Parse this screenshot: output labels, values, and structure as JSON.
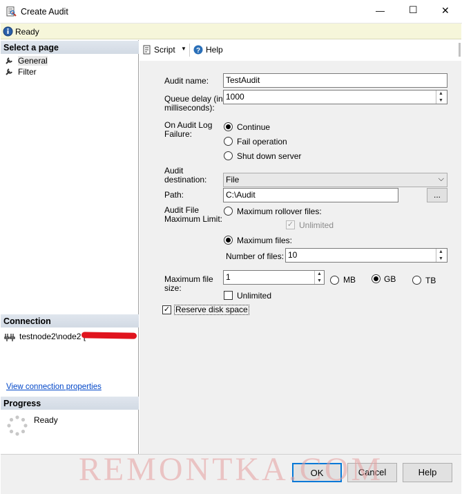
{
  "window": {
    "title": "Create Audit",
    "minimize": "—",
    "maximize": "☐",
    "close": "✕"
  },
  "status": {
    "icon": "info-icon",
    "text": "Ready"
  },
  "left": {
    "select_page_title": "Select a page",
    "pages": [
      {
        "label": "General",
        "icon": "wrench-icon",
        "selected": true
      },
      {
        "label": "Filter",
        "icon": "wrench-icon",
        "selected": false
      }
    ],
    "connection_title": "Connection",
    "connection_server": "testnode2\\node2 [",
    "view_connection_link": "View connection properties",
    "progress_title": "Progress",
    "progress_status": "Ready"
  },
  "toolbar": {
    "script_label": "Script",
    "help_label": "Help"
  },
  "form": {
    "audit_name_label": "Audit name:",
    "audit_name_value": "TestAudit",
    "queue_delay_label_1": "Queue delay (in",
    "queue_delay_label_2": "milliseconds):",
    "queue_delay_value": "1000",
    "on_failure_label_1": "On Audit Log",
    "on_failure_label_2": "Failure:",
    "on_failure_options": [
      {
        "label": "Continue",
        "selected": true
      },
      {
        "label": "Fail operation",
        "selected": false
      },
      {
        "label": "Shut down server",
        "selected": false
      }
    ],
    "destination_label_1": "Audit",
    "destination_label_2": "destination:",
    "destination_value": "File",
    "path_label": "Path:",
    "path_value": "C:\\Audit",
    "browse_label": "...",
    "max_limit_label_1": "Audit File",
    "max_limit_label_2": "Maximum Limit:",
    "max_rollover_label": "Maximum rollover files:",
    "unlimited_label": "Unlimited",
    "max_files_label": "Maximum files:",
    "number_of_files_label": "Number of files:",
    "number_of_files_value": "10",
    "max_file_size_label_1": "Maximum file",
    "max_file_size_label_2": "size:",
    "max_file_size_value": "1",
    "unit_mb": "MB",
    "unit_gb": "GB",
    "unit_tb": "TB",
    "size_unlimited_label": "Unlimited",
    "reserve_disk_label": "Reserve disk space"
  },
  "footer": {
    "ok": "OK",
    "cancel": "Cancel",
    "help": "Help"
  },
  "watermark": "REMONTKA.COM"
}
